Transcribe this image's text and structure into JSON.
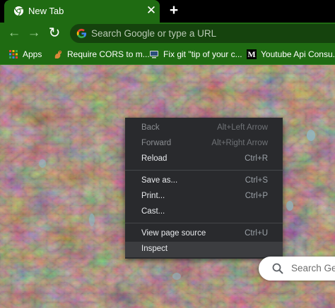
{
  "tab": {
    "title": "New Tab",
    "close_glyph": "✕"
  },
  "new_tab_glyph": "+",
  "toolbar": {
    "back_glyph": "←",
    "forward_glyph": "→",
    "reload_glyph": "↻",
    "omnibox_placeholder": "Search Google or type a URL"
  },
  "bookmarks": [
    {
      "label": "Apps",
      "icon": "apps-grid-icon"
    },
    {
      "label": "Require CORS to m...",
      "icon": "squirrel-icon"
    },
    {
      "label": "Fix git \"tip of your c...",
      "icon": "monitor-icon"
    },
    {
      "label": "Youtube Api Consu...",
      "icon": "medium-m-icon",
      "icon_text": "M"
    }
  ],
  "context_menu": {
    "items": [
      {
        "label": "Back",
        "shortcut": "Alt+Left Arrow",
        "disabled": true
      },
      {
        "label": "Forward",
        "shortcut": "Alt+Right Arrow",
        "disabled": true
      },
      {
        "label": "Reload",
        "shortcut": "Ctrl+R",
        "disabled": false
      },
      {
        "label": "Save as...",
        "shortcut": "Ctrl+S",
        "disabled": false
      },
      {
        "label": "Print...",
        "shortcut": "Ctrl+P",
        "disabled": false
      },
      {
        "label": "Cast...",
        "shortcut": "",
        "disabled": false
      },
      {
        "label": "View page source",
        "shortcut": "Ctrl+U",
        "disabled": false
      },
      {
        "label": "Inspect",
        "shortcut": "",
        "disabled": false,
        "highlighted": true
      }
    ]
  },
  "page_search": {
    "placeholder": "Search Ge"
  },
  "colors": {
    "theme_green": "#1f6b12",
    "menu_bg": "#292a2d",
    "menu_hover": "#3c3d40"
  }
}
